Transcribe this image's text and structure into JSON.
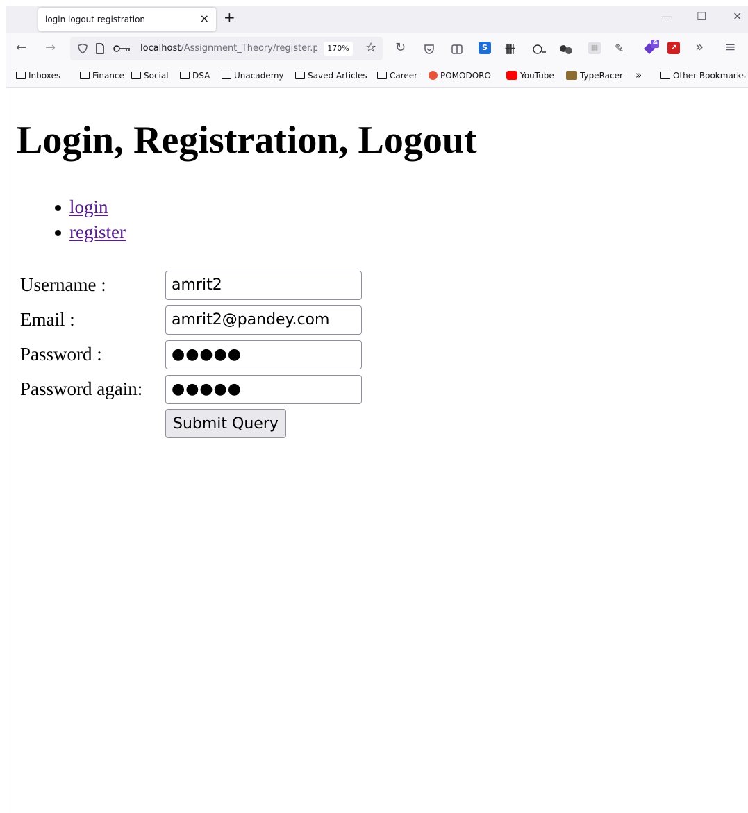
{
  "tab": {
    "title": "login logout registration",
    "close": "×",
    "new": "+"
  },
  "window": {
    "minimize": "—",
    "maximize": "☐",
    "close": "✕"
  },
  "nav": {
    "back": "←",
    "forward": "→",
    "url_host": "localhost",
    "url_path": "/Assignment_Theory/register.php",
    "zoom": "170%",
    "menu": "≡",
    "overflow": "»"
  },
  "extensions": {
    "badge_count": "4"
  },
  "bookmarks": [
    {
      "label": "Inboxes",
      "type": "folder"
    },
    {
      "label": "Finance",
      "type": "folder"
    },
    {
      "label": "Social",
      "type": "folder"
    },
    {
      "label": "DSA",
      "type": "folder"
    },
    {
      "label": "Unacademy",
      "type": "folder"
    },
    {
      "label": "Saved Articles",
      "type": "folder"
    },
    {
      "label": "Career",
      "type": "folder"
    },
    {
      "label": "POMODORO",
      "type": "link",
      "color": "#e8533b"
    },
    {
      "label": "YouTube",
      "type": "link",
      "color": "#ff0000"
    },
    {
      "label": "TypeRacer",
      "type": "link",
      "color": "#8a6d2f"
    }
  ],
  "bookmarks_overflow": "»",
  "bookmarks_other": "Other Bookmarks",
  "page": {
    "title": "Login, Registration, Logout",
    "links": [
      "login",
      "register"
    ],
    "form": {
      "username_label": "Username :",
      "username_value": "amrit2",
      "email_label": "Email :",
      "email_value": "amrit2@pandey.com",
      "password_label": "Password :",
      "password_value": "●●●●●",
      "password_again_label": "Password again:",
      "password_again_value": "●●●●●",
      "submit_label": "Submit Query"
    }
  },
  "colors": {
    "link_visited": "#551a8b",
    "toolbar": "#f9f9fb",
    "tabbar": "#f0f0f4"
  }
}
